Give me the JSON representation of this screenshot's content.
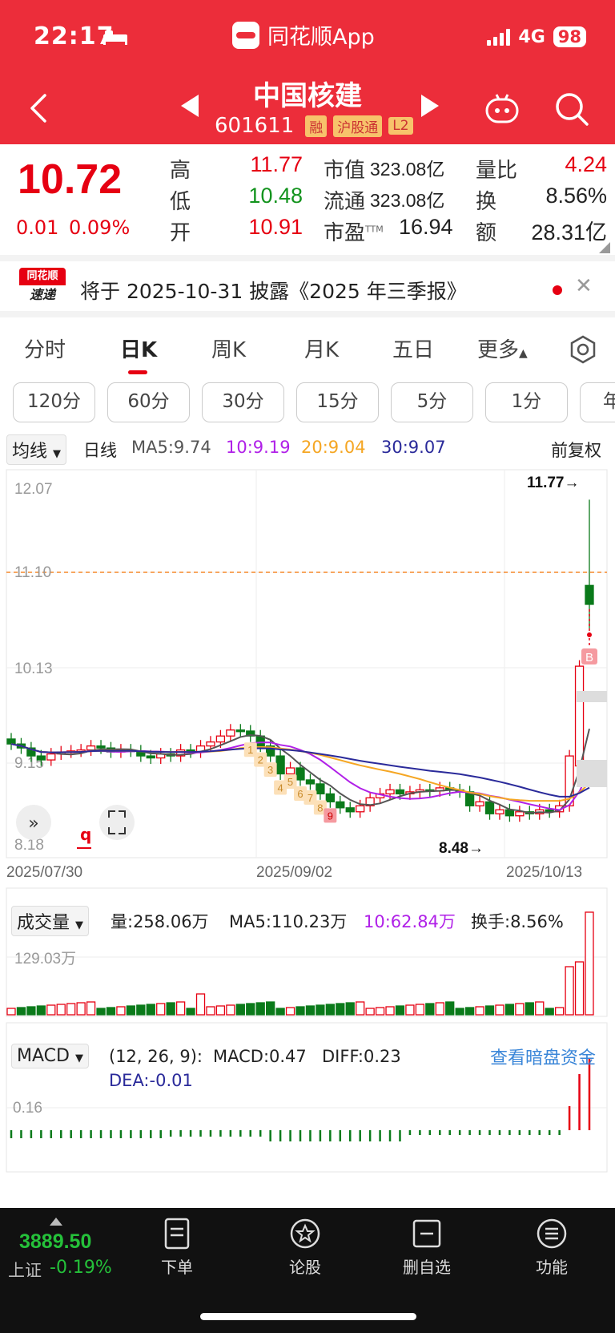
{
  "status": {
    "time": "22:17",
    "app": "同花顺App",
    "network": "4G",
    "battery": "98"
  },
  "header": {
    "name": "中国核建",
    "code": "601611",
    "tags": [
      "融",
      "沪股通",
      "L2"
    ]
  },
  "quote": {
    "price": "10.72",
    "change": "0.01",
    "change_pct": "0.09%",
    "high_label": "高",
    "high": "11.77",
    "low_label": "低",
    "low": "10.48",
    "open_label": "开",
    "open": "10.91",
    "mcap_label": "市值",
    "mcap": "323.08亿",
    "float_label": "流通",
    "float": "323.08亿",
    "pe_label": "市盈",
    "pe_sup": "TTM",
    "pe": "16.94",
    "vr_label": "量比",
    "vr": "4.24",
    "turnover_label": "换",
    "turnover": "8.56%",
    "amount_label": "额",
    "amount": "28.31亿"
  },
  "notice": {
    "logo_top": "同花顺",
    "logo_bottom": "速递",
    "text": "将于 2025-10-31 披露《2025 年三季报》"
  },
  "tabs": [
    "分时",
    "日K",
    "周K",
    "月K",
    "五日",
    "更多"
  ],
  "periods": [
    "120分",
    "60分",
    "30分",
    "15分",
    "5分",
    "1分",
    "年"
  ],
  "kline": {
    "indicator": "均线",
    "period_label": "日线",
    "ma5": "MA5:9.74",
    "ma10": "10:9.19",
    "ma20": "20:9.04",
    "ma30": "30:9.07",
    "adjust": "前复权",
    "y_labels": [
      "12.07",
      "11.10",
      "10.13",
      "9.15",
      "8.18"
    ],
    "dates": [
      "2025/07/30",
      "2025/09/02",
      "2025/10/13"
    ],
    "high_mark": "11.77→",
    "low_mark": "8.48→",
    "nine_labels": [
      "1",
      "2",
      "3",
      "4",
      "5",
      "6",
      "7",
      "8",
      "9"
    ],
    "buy_mark": "B"
  },
  "volume": {
    "indicator": "成交量",
    "vol": "量:258.06万",
    "ma5": "MA5:110.23万",
    "ma10": "10:62.84万",
    "turnover": "换手:8.56%",
    "y_label": "129.03万"
  },
  "macd": {
    "indicator": "MACD",
    "params": "(12, 26, 9):",
    "macd": "MACD:0.47",
    "diff": "DIFF:0.23",
    "dea": "DEA:-0.01",
    "link": "查看暗盘资金",
    "y_label": "0.16"
  },
  "colors": {
    "up": "#e60012",
    "down": "#0a7a1a",
    "ma5": "#555555",
    "ma10": "#b020e8",
    "ma20": "#f5a623",
    "ma30": "#2a2a9a"
  },
  "chart_data": {
    "type": "candlestick",
    "x_range": [
      "2025/07/30",
      "2025/10/13"
    ],
    "ylim": [
      8.18,
      12.07
    ],
    "high": 11.77,
    "low": 8.48,
    "last_close": 10.72
  },
  "bottom_nav": {
    "index_value": "3889.50",
    "index_name": "上证",
    "index_change": "-0.19%",
    "items": [
      "下单",
      "论股",
      "删自选",
      "功能"
    ]
  }
}
